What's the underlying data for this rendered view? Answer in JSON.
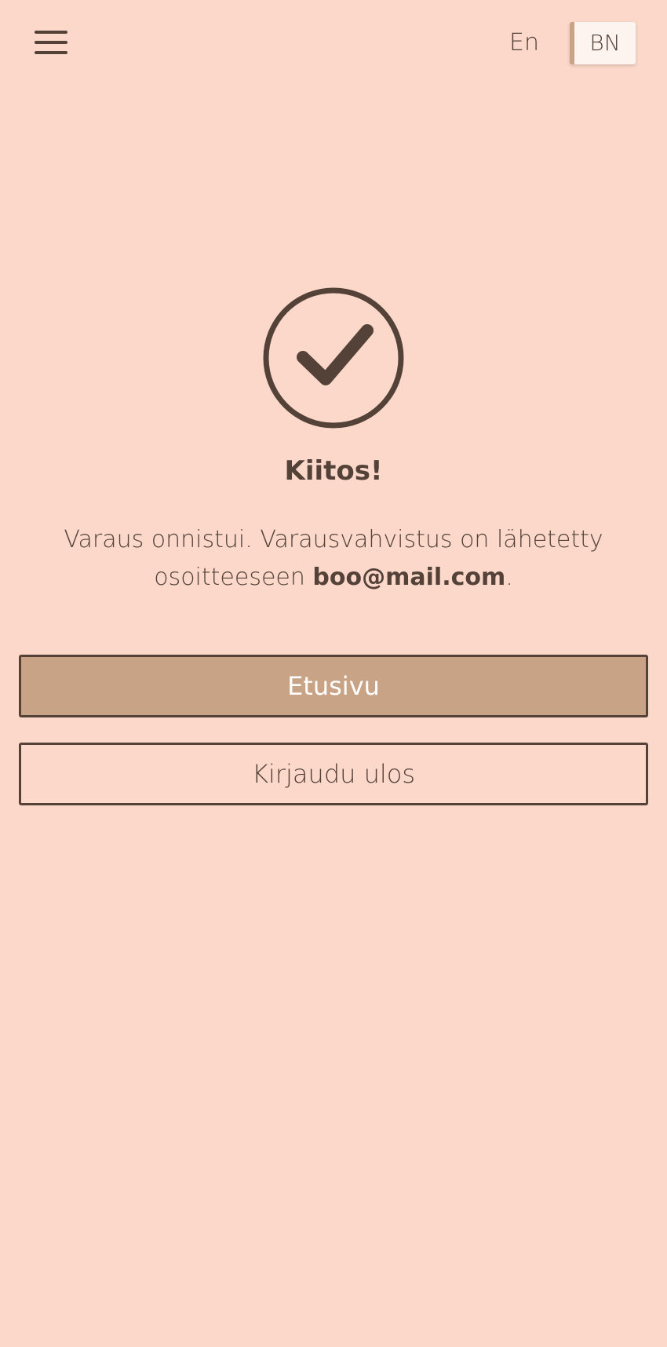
{
  "header": {
    "menu_icon": "hamburger-menu-icon",
    "lang_en": "En",
    "lang_bn": "BN"
  },
  "confirmation": {
    "icon": "check-circle-icon",
    "title": "Kiitos!",
    "message_part1": "Varaus onnistui. Varausvahvistus on lähetetty osoitteeseen ",
    "email": "boo@mail.com",
    "message_part2": "."
  },
  "actions": {
    "home_label": "Etusivu",
    "logout_label": "Kirjaudu ulos"
  },
  "colors": {
    "background": "#fbd8c9",
    "text": "#544239",
    "accent": "#c8a386",
    "active_lang_bg": "#fdf3ef"
  }
}
